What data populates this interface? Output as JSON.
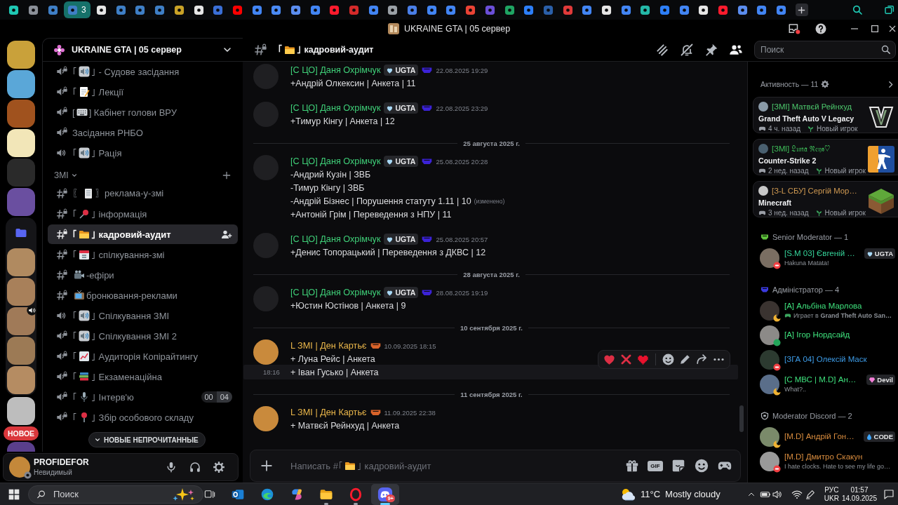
{
  "browser_tabs": [
    {
      "color": "#1fc8b4",
      "selected": false
    },
    {
      "color": "#8b9099",
      "selected": false
    },
    {
      "color": "#3f7fc6",
      "selected": false
    },
    {
      "color": "#3f7fc6",
      "selected": true,
      "count": "3"
    },
    {
      "color": "#e6e6e6",
      "selected": false
    },
    {
      "color": "#3f7fc6",
      "selected": false
    },
    {
      "color": "#3f7fc6",
      "selected": false
    },
    {
      "color": "#3f7fc6",
      "selected": false
    },
    {
      "color": "#c9a227",
      "selected": false
    },
    {
      "color": "#e6e6e6",
      "selected": false
    },
    {
      "color": "#3b6fd6",
      "selected": false
    },
    {
      "color": "#ff0000",
      "selected": false
    },
    {
      "color": "#4285f4",
      "selected": false
    },
    {
      "color": "#4a8af4",
      "selected": false
    },
    {
      "color": "#5b8def",
      "selected": false
    },
    {
      "color": "#4285f4",
      "selected": false
    },
    {
      "color": "#ff1b2d",
      "selected": false
    },
    {
      "color": "#d42a2a",
      "selected": false
    },
    {
      "color": "#4285f4",
      "selected": false
    },
    {
      "color": "#9aa0a6",
      "selected": false
    },
    {
      "color": "#4a7fe8",
      "selected": false
    },
    {
      "color": "#4285f4",
      "selected": false
    },
    {
      "color": "#4285f4",
      "selected": false
    },
    {
      "color": "#ea4335",
      "selected": false
    },
    {
      "color": "#6b4fd8",
      "selected": false
    },
    {
      "color": "#1fa463",
      "selected": false
    },
    {
      "color": "#2d7ff9",
      "selected": false
    },
    {
      "color": "#2b5fa8",
      "selected": false
    },
    {
      "color": "#e03a3a",
      "selected": false
    },
    {
      "color": "#4285f4",
      "selected": false
    },
    {
      "color": "#e6e6e6",
      "selected": false
    },
    {
      "color": "#4285f4",
      "selected": false
    },
    {
      "color": "#24b8a8",
      "selected": false
    },
    {
      "color": "#2d7ff9",
      "selected": false
    },
    {
      "color": "#4285f4",
      "selected": false
    },
    {
      "color": "#e6e6e6",
      "selected": false
    },
    {
      "color": "#ff1b2d",
      "selected": false
    },
    {
      "color": "#5b8def",
      "selected": false
    },
    {
      "color": "#4285f4",
      "selected": false
    },
    {
      "color": "#4285f4",
      "selected": false
    }
  ],
  "window": {
    "title": "UKRAINE GTA | 05 сервер"
  },
  "servers": [
    {
      "kind": "server",
      "color": "#c9a13a",
      "in_voice": false
    },
    {
      "kind": "server",
      "color": "#5aa7d8",
      "in_voice": false
    },
    {
      "kind": "server",
      "color": "#a0521e",
      "in_voice": false
    },
    {
      "kind": "server",
      "color": "#f2e6b8",
      "in_voice": false
    },
    {
      "kind": "server",
      "color": "#2a2a2a",
      "in_voice": false
    },
    {
      "kind": "server",
      "color": "#6a4fa0",
      "in_voice": false
    },
    {
      "kind": "folder",
      "expanded": true,
      "children": [
        {
          "color": "#b08a60",
          "in_voice": false
        },
        {
          "color": "#a8805a",
          "in_voice": false
        },
        {
          "color": "#a07a58",
          "in_voice": true
        },
        {
          "color": "#9c7a55",
          "in_voice": false
        },
        {
          "color": "#b58c62",
          "in_voice": false
        }
      ]
    },
    {
      "kind": "server",
      "color": "#bdbdbd",
      "in_voice": false
    },
    {
      "kind": "new-label",
      "text": "НОВОЕ"
    },
    {
      "kind": "server",
      "color": "#5a3f8c",
      "in_voice": false
    }
  ],
  "sidebar": {
    "server": "UKRAINE GTA | 05 сервер",
    "sections": [
      {
        "channels": [
          {
            "kind": "voice",
            "locked": true,
            "selected": false,
            "lead": "｢",
            "emoji": {
              "kind": "speaker"
            },
            "name": "｣ - Судове засідання"
          },
          {
            "kind": "voice",
            "locked": true,
            "selected": false,
            "lead": "｢",
            "emoji": {
              "kind": "memo"
            },
            "name": "｣ Лекції"
          },
          {
            "kind": "voice",
            "locked": true,
            "selected": false,
            "lead": "[",
            "emoji": {
              "kind": "keyboard"
            },
            "name": "] Кабінет голови ВРУ"
          },
          {
            "kind": "voice",
            "locked": true,
            "selected": false,
            "name": "Засідання РНБО"
          },
          {
            "kind": "voice",
            "locked": false,
            "selected": false,
            "lead": "｢",
            "emoji": {
              "kind": "speaker"
            },
            "name": "｣ Рація"
          }
        ]
      },
      {
        "category": "ЗМІ",
        "expanded": true,
        "channels": [
          {
            "kind": "text",
            "locked": true,
            "selected": false,
            "lead": "〖",
            "emoji": {
              "kind": "page"
            },
            "name": "〗реклама-у-змі"
          },
          {
            "kind": "text",
            "locked": true,
            "selected": false,
            "lead": "｢",
            "emoji": {
              "kind": "pin"
            },
            "name": "｣ інформація"
          },
          {
            "kind": "text",
            "locked": true,
            "selected": true,
            "lead": "｢",
            "emoji": {
              "kind": "folder"
            },
            "name": "｣ кадровий-аудит"
          },
          {
            "kind": "text",
            "locked": true,
            "selected": false,
            "lead": "｢",
            "emoji": {
              "kind": "calendar"
            },
            "name": "｣ спілкування-змі"
          },
          {
            "kind": "text",
            "locked": true,
            "selected": false,
            "emoji": {
              "kind": "camera"
            },
            "name": "-ефіри"
          },
          {
            "kind": "text",
            "locked": true,
            "selected": false,
            "emoji": {
              "kind": "tv"
            },
            "name": "бронювання-реклами"
          },
          {
            "kind": "voice",
            "locked": false,
            "selected": false,
            "lead": "｢",
            "emoji": {
              "kind": "speaker"
            },
            "name": "｣ Спілкування ЗМІ"
          },
          {
            "kind": "voice",
            "locked": true,
            "selected": false,
            "lead": "｢",
            "emoji": {
              "kind": "speaker"
            },
            "name": "｣ Спілкування ЗМІ 2"
          },
          {
            "kind": "voice",
            "locked": true,
            "selected": false,
            "lead": "｢",
            "emoji": {
              "kind": "chart"
            },
            "name": "｣ Аудиторія Копірайтингу"
          },
          {
            "kind": "voice",
            "locked": true,
            "selected": false,
            "lead": "｢",
            "emoji": {
              "kind": "books"
            },
            "name": "｣ Екзаменаційна"
          },
          {
            "kind": "voice",
            "locked": true,
            "selected": false,
            "lead": "｢",
            "emoji": {
              "kind": "mic"
            },
            "name": "｣ Інтерв'ю",
            "users": "00",
            "limit": "04"
          },
          {
            "kind": "voice",
            "locked": true,
            "selected": false,
            "lead": "｢",
            "emoji": {
              "kind": "roundpin"
            },
            "name": "｣ Збір особового складу"
          }
        ]
      }
    ],
    "unread_pill": "НОВЫЕ НЕПРОЧИТАННЫЕ"
  },
  "user": {
    "name": "PROFIDEFOR",
    "status_text": "Невидимый",
    "status": {
      "kind": "invisible"
    },
    "avatar": {
      "color": "#c4883a"
    }
  },
  "channel_header": {
    "kind": "text",
    "locked": true,
    "lead": "｢",
    "emoji": {
      "kind": "folder"
    },
    "name": "｣ кадровий-аудит"
  },
  "toolbar": [
    {
      "kind": "threads",
      "selected": false
    },
    {
      "kind": "mute",
      "selected": false
    },
    {
      "kind": "pin",
      "selected": false
    },
    {
      "kind": "members",
      "selected": true
    }
  ],
  "search": {
    "placeholder": "Поиск"
  },
  "messages": [
    {
      "kind": "message",
      "author": "[С ЦО] Даня Охрімчук",
      "color": "#3fcf78",
      "avatar": {
        "color": "#1f1f22"
      },
      "tag": "UGTA",
      "role_icon": {
        "color": "#3b22d6"
      },
      "time": "22.08.2025 19:29",
      "lines": [
        "+Андрій Олкексин | Анкета | 11"
      ]
    },
    {
      "kind": "message",
      "author": "[С ЦО] Даня Охрімчук",
      "color": "#3fcf78",
      "avatar": {
        "color": "#1f1f22"
      },
      "tag": "UGTA",
      "role_icon": {
        "color": "#3b22d6"
      },
      "time": "22.08.2025 23:29",
      "lines": [
        "+Тимур Кінгу | Анкета | 12"
      ]
    },
    {
      "kind": "divider",
      "text": "25 августа 2025 г."
    },
    {
      "kind": "message",
      "author": "[С ЦО] Даня Охрімчук",
      "color": "#3fcf78",
      "avatar": {
        "color": "#1f1f22"
      },
      "tag": "UGTA",
      "role_icon": {
        "color": "#3b22d6"
      },
      "time": "25.08.2025 20:28",
      "lines": [
        "-Андрий Кузін | ЗВБ",
        "-Тимур Кінгу | ЗВБ",
        "-Андрій Бізнес | Порушення статуту 1.11 | 10"
      ],
      "edited": "(изменено)"
    },
    {
      "kind": "continuation",
      "hovered": false,
      "text": "+Антоній Грім | Переведення з НПУ | 11"
    },
    {
      "kind": "message",
      "author": "[С ЦО] Даня Охрімчук",
      "color": "#3fcf78",
      "avatar": {
        "color": "#1f1f22"
      },
      "tag": "UGTA",
      "role_icon": {
        "color": "#3b22d6"
      },
      "time": "25.08.2025 20:57",
      "lines": [
        "+Денис Топорацький | Переведення з ДКВС | 12"
      ]
    },
    {
      "kind": "divider",
      "text": "28 августа 2025 г."
    },
    {
      "kind": "message",
      "author": "[С ЦО] Даня Охрімчук",
      "color": "#3fcf78",
      "avatar": {
        "color": "#1f1f22"
      },
      "tag": "UGTA",
      "role_icon": {
        "color": "#3b22d6"
      },
      "time": "28.08.2025 19:19",
      "lines": [
        "+Юстин Юстінов | Анкета | 9"
      ]
    },
    {
      "kind": "divider",
      "text": "10 сентября 2025 г."
    },
    {
      "kind": "message",
      "author": "L ЗМІ | Ден Картьє",
      "color": "#e9b64a",
      "avatar": {
        "color": "#c98a3c"
      },
      "role_icon": {
        "color": "#d8632a"
      },
      "time": "10.09.2025 18:15",
      "lines": [
        "+ Луна Рейс | Анкета"
      ]
    },
    {
      "kind": "continuation",
      "hovered": true,
      "time": "18:16",
      "text": "+ Іван Гусько | Анкета",
      "actions": [
        {
          "kind": "heart"
        },
        {
          "kind": "cross"
        },
        {
          "kind": "pixel-heart"
        },
        {
          "kind": "react"
        },
        {
          "kind": "edit"
        },
        {
          "kind": "forward"
        },
        {
          "kind": "more"
        }
      ]
    },
    {
      "kind": "divider",
      "text": "11 сентября 2025 г."
    },
    {
      "kind": "message",
      "author": "L ЗМІ | Ден Картьє",
      "color": "#e9b64a",
      "avatar": {
        "color": "#c98a3c"
      },
      "role_icon": {
        "color": "#d8632a"
      },
      "time": "11.09.2025 22:38",
      "lines": [
        "+ Матвєй Рейнхуд | Анкета"
      ]
    }
  ],
  "composer": {
    "placeholder": [
      "Написать #｢",
      "｣ кадровий-аудит"
    ],
    "emoji": {
      "kind": "folder"
    },
    "buttons": [
      {
        "kind": "gift"
      },
      {
        "kind": "gif",
        "label": "GIF"
      },
      {
        "kind": "sticker"
      },
      {
        "kind": "emoji"
      },
      {
        "kind": "activity"
      }
    ]
  },
  "activity": {
    "title": "Активность — 11",
    "cards": [
      {
        "user": "[ЗМІ] Матвєй Рейнхуд",
        "color": "#4cc76c",
        "avatar": {
          "color": "#8a9aa8"
        },
        "game": "Grand Theft Auto V Legacy",
        "time": "4 ч. назад",
        "note": "Новый игрок",
        "art": {
          "kind": "gta"
        }
      },
      {
        "user": "[ЗМl] 𝔏𝔲𝔫𝔞 ℜ𝔢𝔶𝔰♡",
        "color": "#3fbf5a",
        "avatar": {
          "color": "#4a6070"
        },
        "game": "Counter-Strike 2",
        "time": "2 нед. назад",
        "note": "Новый игрок",
        "art": {
          "kind": "cs"
        }
      },
      {
        "user": "[З-L СБУ] Сергій Мор…",
        "color": "#d09a52",
        "avatar": {
          "color": "#c8c8c8"
        },
        "game": "Minecraft",
        "time": "3 нед. назад",
        "note": "Новый игрок",
        "art": {
          "kind": "minecraft"
        }
      }
    ]
  },
  "member_groups": [
    {
      "title": "Senior Moderator — 1",
      "icon": {
        "kind": "emblem",
        "color": "#5fc23c"
      },
      "members": [
        {
          "name": "[S.M 03] Євгеній …",
          "color": "#35d49a",
          "avatar": {
            "color": "#7a6e62"
          },
          "status": {
            "kind": "dnd"
          },
          "tag": {
            "kind": "heart",
            "text": "UGTA"
          },
          "subtitle": "Hakuna Matata!"
        }
      ]
    },
    {
      "title": "Адміністратор — 4",
      "icon": {
        "kind": "emblem",
        "color": "#3b3ae0"
      },
      "members": [
        {
          "name": "[A] Альбіна Марлова",
          "color": "#3ee07c",
          "avatar": {
            "color": "#3a3330"
          },
          "status": {
            "kind": "idle"
          },
          "activity": "Играет в **Grand Theft Auto San…**"
        },
        {
          "name": "[A] Ігор Нордсайд",
          "color": "#3ee07c",
          "avatar": {
            "color": "#8c8a88"
          },
          "status": {
            "kind": "online"
          }
        },
        {
          "name": "[ЗГА 04] Олексій Маск",
          "color": "#3d9be6",
          "avatar": {
            "color": "#2c3a30"
          },
          "status": {
            "kind": "dnd"
          }
        },
        {
          "name": "[С МВС | M.D] Ан…",
          "color": "#3ee07c",
          "avatar": {
            "color": "#5a6e8a"
          },
          "status": {
            "kind": "idle"
          },
          "tag": {
            "kind": "gem",
            "text": "Devil"
          },
          "subtitle": "What?.."
        }
      ]
    },
    {
      "title": "Moderator Discord — 2",
      "icon": {
        "kind": "shield"
      },
      "members": [
        {
          "name": "[M.D] Андрій Гон…",
          "color": "#d98c3e",
          "avatar": {
            "color": "#7a8a6a"
          },
          "status": {
            "kind": "idle"
          },
          "tag": {
            "kind": "drop",
            "text": "CODE"
          }
        },
        {
          "name": "[M.D] Дмитро Скакун",
          "color": "#d98c3e",
          "avatar": {
            "color": "#9a9a9a"
          },
          "status": {
            "kind": "dnd"
          },
          "subtitle": "I hate clocks. Hate to see my life go…"
        }
      ]
    }
  ],
  "taskbar": {
    "search": {
      "placeholder": "Поиск"
    },
    "apps": [
      {
        "kind": "taskview",
        "running": false,
        "selected": false
      },
      {
        "kind": "mail",
        "running": false,
        "selected": false
      },
      {
        "kind": "wave",
        "running": false,
        "selected": false
      },
      {
        "kind": "swirl",
        "running": false,
        "selected": false
      },
      {
        "kind": "files",
        "running": true,
        "selected": false
      },
      {
        "kind": "ring",
        "running": true,
        "selected": false
      },
      {
        "kind": "chat",
        "running": true,
        "selected": true,
        "badge": "9+"
      }
    ],
    "weather": {
      "temp": "11°C",
      "text": "Mostly cloudy"
    },
    "language": [
      "РУС",
      "UKR"
    ],
    "clock": {
      "time": "01:57",
      "date": "14.09.2025"
    }
  }
}
